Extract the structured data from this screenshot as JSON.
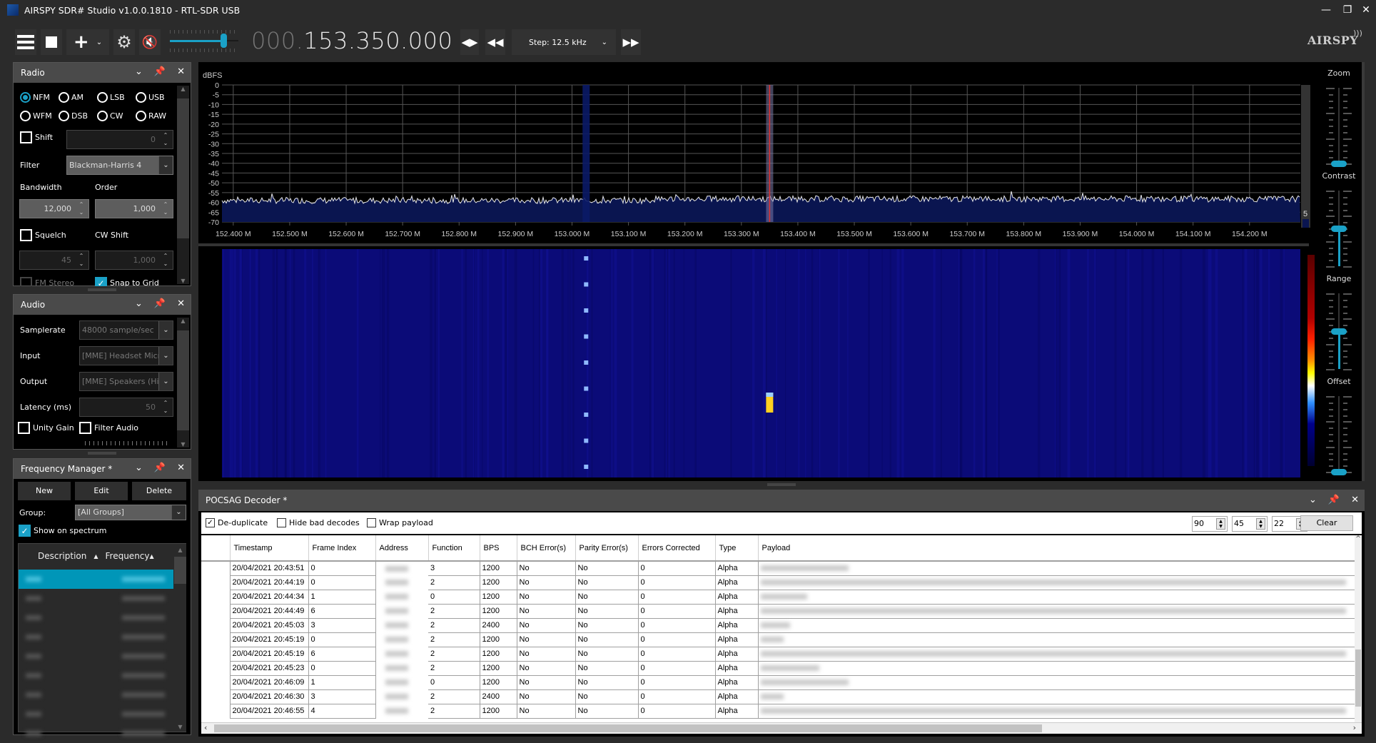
{
  "window": {
    "title": "AIRSPY SDR# Studio v1.0.0.1810 - RTL-SDR USB",
    "minimize": "—",
    "restore": "❐",
    "close": "✕"
  },
  "toolbar": {
    "menu_icon": "hamburger-menu",
    "stop_icon": "stop-square",
    "add_icon": "plus",
    "settings_icon": "gear",
    "mute_icon": "speaker-muted",
    "volume_level": 0.78,
    "frequency_prefix": "000.",
    "frequency_main": "153.350.000",
    "step_label": "Step: 12.5 kHz",
    "logo": "AIRSPY"
  },
  "radio_panel": {
    "title": "Radio",
    "modes": [
      {
        "label": "NFM",
        "selected": true
      },
      {
        "label": "AM",
        "selected": false
      },
      {
        "label": "LSB",
        "selected": false
      },
      {
        "label": "USB",
        "selected": false
      },
      {
        "label": "WFM",
        "selected": false
      },
      {
        "label": "DSB",
        "selected": false
      },
      {
        "label": "CW",
        "selected": false
      },
      {
        "label": "RAW",
        "selected": false
      }
    ],
    "shift_label": "Shift",
    "shift_checked": false,
    "shift_value": "0",
    "filter_label": "Filter",
    "filter_value": "Blackman-Harris 4",
    "bandwidth_label": "Bandwidth",
    "bandwidth_value": "12,000",
    "order_label": "Order",
    "order_value": "1,000",
    "squelch_label": "Squelch",
    "squelch_checked": false,
    "squelch_value": "45",
    "cwshift_label": "CW Shift",
    "cwshift_value": "1,000",
    "fmstereo_label": "FM Stereo",
    "snap_label": "Snap to Grid",
    "snap_checked": true
  },
  "audio_panel": {
    "title": "Audio",
    "samplerate_label": "Samplerate",
    "samplerate_value": "48000 sample/sec",
    "input_label": "Input",
    "input_value": "[MME] Headset Micr",
    "output_label": "Output",
    "output_value": "[MME] Speakers (Hig",
    "latency_label": "Latency (ms)",
    "latency_value": "50",
    "unity_gain_label": "Unity Gain",
    "filter_audio_label": "Filter Audio"
  },
  "freq_manager": {
    "title": "Frequency Manager *",
    "new_label": "New",
    "edit_label": "Edit",
    "delete_label": "Delete",
    "group_label": "Group:",
    "group_value": "[All Groups]",
    "show_spectrum_label": "Show on spectrum",
    "show_spectrum_checked": true,
    "col_description": "Description",
    "col_frequency": "Frequency",
    "rows": 9,
    "selected_row": 0
  },
  "spectrum": {
    "unit_label": "dBFS",
    "side_value": "5",
    "sliders": {
      "zoom_label": "Zoom",
      "zoom_value": 0.0,
      "contrast_label": "Contrast",
      "contrast_value": 0.5,
      "range_label": "Range",
      "range_value": 0.5,
      "offset_label": "Offset",
      "offset_value": 0.0
    }
  },
  "chart_data": {
    "type": "line",
    "title": "",
    "ylabel": "dBFS",
    "xlabel": "",
    "ylim": [
      -70,
      0
    ],
    "xlim_mhz": [
      152.38,
      154.29
    ],
    "y_ticks": [
      "0",
      "-5",
      "-10",
      "-15",
      "-20",
      "-25",
      "-30",
      "-35",
      "-40",
      "-45",
      "-50",
      "-55",
      "-60",
      "-65",
      "-70"
    ],
    "x_ticks": [
      "152.400 M",
      "152.500 M",
      "152.600 M",
      "152.700 M",
      "152.800 M",
      "152.900 M",
      "153.000 M",
      "153.100 M",
      "153.200 M",
      "153.300 M",
      "153.400 M",
      "153.500 M",
      "153.600 M",
      "153.700 M",
      "153.800 M",
      "153.900 M",
      "154.000 M",
      "154.100 M",
      "154.200 M"
    ],
    "x_tick_values": [
      152.4,
      152.5,
      152.6,
      152.7,
      152.8,
      152.9,
      153.0,
      153.1,
      153.2,
      153.3,
      153.4,
      153.5,
      153.6,
      153.7,
      153.8,
      153.9,
      154.0,
      154.1,
      154.2
    ],
    "noise_floor_dbfs": -59,
    "noise_ripple_db": 2,
    "tuned_frequency_mhz": 153.35,
    "filter_bandwidth_khz": 12.5,
    "marker_frequency_mhz": 153.025,
    "grid": true
  },
  "pocsag": {
    "title": "POCSAG Decoder *",
    "dedup_label": "De-duplicate",
    "dedup_checked": true,
    "hidebad_label": "Hide bad decodes",
    "hidebad_checked": false,
    "wrap_label": "Wrap payload",
    "wrap_checked": false,
    "num1": "90",
    "num2": "45",
    "num3": "22",
    "clear_label": "Clear",
    "columns": [
      "",
      "Timestamp",
      "Frame Index",
      "Address",
      "Function",
      "BPS",
      "BCH Error(s)",
      "Parity Error(s)",
      "Errors Corrected",
      "Type",
      "Payload"
    ],
    "rows": [
      {
        "timestamp": "20/04/2021 20:43:51",
        "frame": "0",
        "function": "3",
        "bps": "1200",
        "bch": "No",
        "parity": "No",
        "corrected": "0",
        "type": "Alpha"
      },
      {
        "timestamp": "20/04/2021 20:44:19",
        "frame": "0",
        "function": "2",
        "bps": "1200",
        "bch": "No",
        "parity": "No",
        "corrected": "0",
        "type": "Alpha"
      },
      {
        "timestamp": "20/04/2021 20:44:34",
        "frame": "1",
        "function": "0",
        "bps": "1200",
        "bch": "No",
        "parity": "No",
        "corrected": "0",
        "type": "Alpha"
      },
      {
        "timestamp": "20/04/2021 20:44:49",
        "frame": "6",
        "function": "2",
        "bps": "1200",
        "bch": "No",
        "parity": "No",
        "corrected": "0",
        "type": "Alpha"
      },
      {
        "timestamp": "20/04/2021 20:45:03",
        "frame": "3",
        "function": "2",
        "bps": "2400",
        "bch": "No",
        "parity": "No",
        "corrected": "0",
        "type": "Alpha"
      },
      {
        "timestamp": "20/04/2021 20:45:19",
        "frame": "0",
        "function": "2",
        "bps": "1200",
        "bch": "No",
        "parity": "No",
        "corrected": "0",
        "type": "Alpha"
      },
      {
        "timestamp": "20/04/2021 20:45:19",
        "frame": "6",
        "function": "2",
        "bps": "1200",
        "bch": "No",
        "parity": "No",
        "corrected": "0",
        "type": "Alpha"
      },
      {
        "timestamp": "20/04/2021 20:45:23",
        "frame": "0",
        "function": "2",
        "bps": "1200",
        "bch": "No",
        "parity": "No",
        "corrected": "0",
        "type": "Alpha"
      },
      {
        "timestamp": "20/04/2021 20:46:09",
        "frame": "1",
        "function": "0",
        "bps": "1200",
        "bch": "No",
        "parity": "No",
        "corrected": "0",
        "type": "Alpha"
      },
      {
        "timestamp": "20/04/2021 20:46:30",
        "frame": "3",
        "function": "2",
        "bps": "2400",
        "bch": "No",
        "parity": "No",
        "corrected": "0",
        "type": "Alpha"
      },
      {
        "timestamp": "20/04/2021 20:46:55",
        "frame": "4",
        "function": "2",
        "bps": "1200",
        "bch": "No",
        "parity": "No",
        "corrected": "0",
        "type": "Alpha"
      }
    ],
    "payload_lengths": [
      0.15,
      1.0,
      0.08,
      1.0,
      0.05,
      0.04,
      1.0,
      0.1,
      0.15,
      0.04,
      1.0
    ]
  },
  "colors": {
    "accent": "#1aa1c7",
    "spectrum_fill": "#0a1550",
    "waterfall_bg": "#0d0d7a",
    "tuned_marker": "#e03030"
  }
}
